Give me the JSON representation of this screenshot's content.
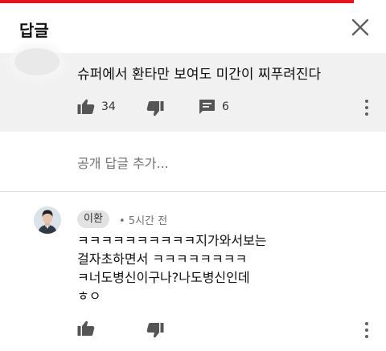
{
  "header": {
    "title": "답글"
  },
  "video_progress": 0.917,
  "parent_comment": {
    "text": "슈퍼에서 환타만 보여도 미간이 찌푸려진다",
    "likes": "34",
    "replies": "6"
  },
  "add_reply": {
    "placeholder": "공개 답글 추가..."
  },
  "reply": {
    "author": "이환",
    "time": "• 5시간 전",
    "lines": [
      "ㅋㅋㅋㅋㅋㅋㅋㅋㅋㅋ지가와서보는",
      "걸자초하면서 ㅋㅋㅋㅋㅋㅋㅋㅋ",
      "ㅋ너도병신이구나?나도병신인데",
      "ㅎㅇ"
    ]
  },
  "colors": {
    "accent": "#e5151d",
    "parent_bg": "#f1f1f1",
    "secondary_text": "#717171"
  },
  "icons": [
    "close-icon",
    "thumbs-up-icon",
    "thumbs-down-icon",
    "reply-icon",
    "more-vertical-icon"
  ]
}
